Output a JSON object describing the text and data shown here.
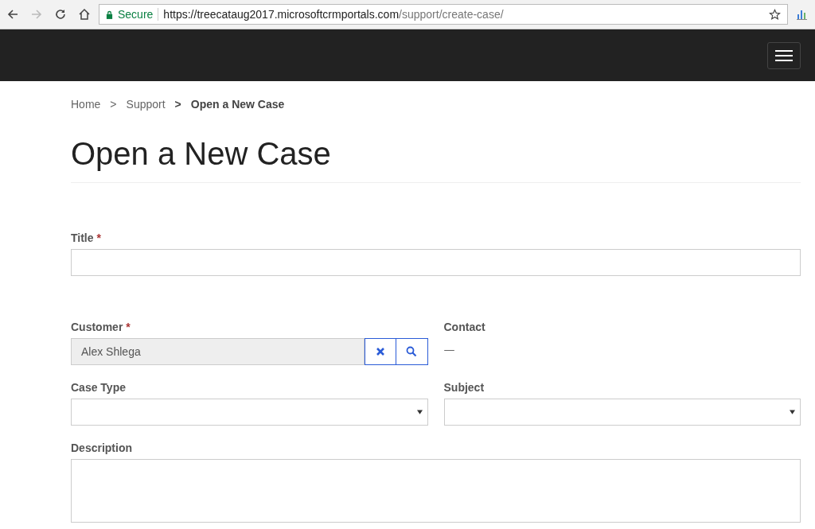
{
  "browser": {
    "secure_label": "Secure",
    "url_host": "https://treecataug2017.microsoftcrmportals.com",
    "url_path": "/support/create-case/"
  },
  "breadcrumb": {
    "items": [
      {
        "label": "Home",
        "current": false
      },
      {
        "label": "Support",
        "current": false
      },
      {
        "label": "Open a New Case",
        "current": true
      }
    ],
    "separator": ">"
  },
  "page_title": "Open a New Case",
  "form_rows": [
    {
      "fields": [
        {
          "kind": "text",
          "label": "Title",
          "required_mark": "*"
        }
      ]
    },
    {
      "fields": [
        {
          "kind": "lookup",
          "label": "Customer",
          "required_mark": "*",
          "value": "Alex Shlega"
        },
        {
          "kind": "readonly",
          "label": "Contact",
          "value": "—"
        }
      ]
    },
    {
      "fields": [
        {
          "kind": "select",
          "label": "Case Type"
        },
        {
          "kind": "select",
          "label": "Subject"
        }
      ]
    },
    {
      "fields": [
        {
          "kind": "textarea",
          "label": "Description"
        }
      ]
    }
  ]
}
